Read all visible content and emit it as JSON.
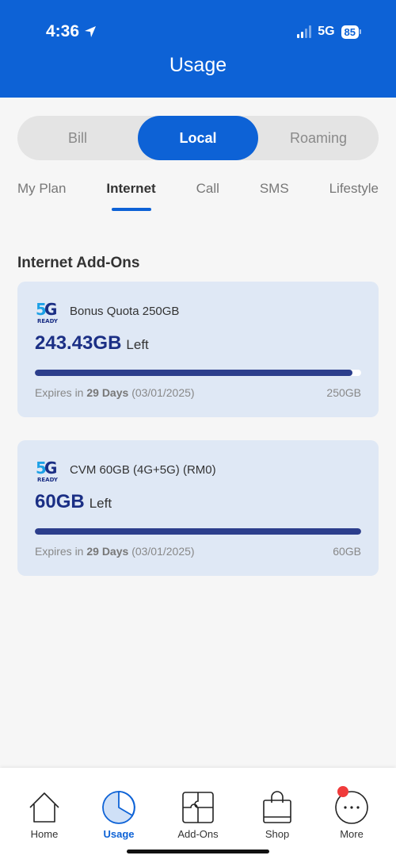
{
  "status_bar": {
    "time": "4:36",
    "network": "5G",
    "battery": "85"
  },
  "header": {
    "title": "Usage"
  },
  "segments": [
    {
      "label": "Bill",
      "active": false
    },
    {
      "label": "Local",
      "active": true
    },
    {
      "label": "Roaming",
      "active": false
    }
  ],
  "subtabs": [
    {
      "label": "My Plan",
      "active": false
    },
    {
      "label": "Internet",
      "active": true
    },
    {
      "label": "Call",
      "active": false
    },
    {
      "label": "SMS",
      "active": false
    },
    {
      "label": "Lifestyle",
      "active": false
    }
  ],
  "section": {
    "title": "Internet Add-Ons"
  },
  "addons": [
    {
      "logo_icon": "5g-ready-icon",
      "name": "Bonus Quota 250GB",
      "remaining": "243.43GB",
      "left_label": "Left",
      "remaining_fraction": 0.974,
      "expiry_prefix": "Expires in",
      "expiry_days": "29 Days",
      "expiry_date": "(03/01/2025)",
      "total": "250GB"
    },
    {
      "logo_icon": "5g-ready-icon",
      "name": "CVM 60GB (4G+5G) (RM0)",
      "remaining": "60GB",
      "left_label": "Left",
      "remaining_fraction": 1.0,
      "expiry_prefix": "Expires in",
      "expiry_days": "29 Days",
      "expiry_date": "(03/01/2025)",
      "total": "60GB"
    }
  ],
  "bottom_nav": [
    {
      "label": "Home",
      "icon": "home-icon",
      "active": false
    },
    {
      "label": "Usage",
      "icon": "pie-chart-icon",
      "active": true
    },
    {
      "label": "Add-Ons",
      "icon": "puzzle-icon",
      "active": false
    },
    {
      "label": "Shop",
      "icon": "shopping-bag-icon",
      "active": false
    },
    {
      "label": "More",
      "icon": "more-icon",
      "active": false,
      "notification": true
    }
  ],
  "colors": {
    "brand": "#0d62d6",
    "bar": "#2c3e8c",
    "card": "#dfe8f5",
    "notification": "#f03b3b"
  }
}
